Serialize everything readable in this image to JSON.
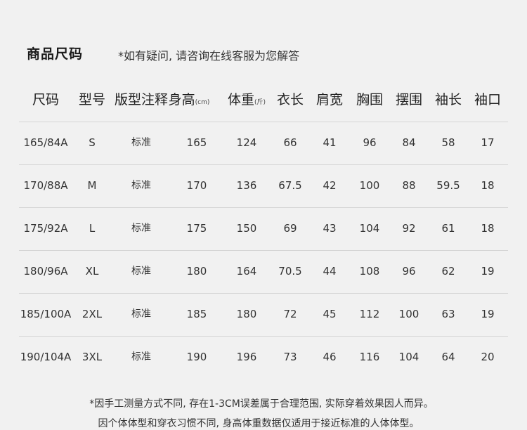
{
  "title": "商品尺码",
  "subtitle": "*如有疑问, 请咨询在线客服为您解答",
  "headers": [
    {
      "label": "尺码",
      "unit": ""
    },
    {
      "label": "型号",
      "unit": ""
    },
    {
      "label": "版型注释",
      "unit": ""
    },
    {
      "label": "身高",
      "unit": "(cm)"
    },
    {
      "label": "体重",
      "unit": "(斤)"
    },
    {
      "label": "衣长",
      "unit": ""
    },
    {
      "label": "肩宽",
      "unit": ""
    },
    {
      "label": "胸围",
      "unit": ""
    },
    {
      "label": "摆围",
      "unit": ""
    },
    {
      "label": "袖长",
      "unit": ""
    },
    {
      "label": "袖口",
      "unit": ""
    }
  ],
  "rows": [
    [
      "165/84A",
      "S",
      "标准",
      "165",
      "124",
      "66",
      "41",
      "96",
      "84",
      "58",
      "17"
    ],
    [
      "170/88A",
      "M",
      "标准",
      "170",
      "136",
      "67.5",
      "42",
      "100",
      "88",
      "59.5",
      "18"
    ],
    [
      "175/92A",
      "L",
      "标准",
      "175",
      "150",
      "69",
      "43",
      "104",
      "92",
      "61",
      "18"
    ],
    [
      "180/96A",
      "XL",
      "标准",
      "180",
      "164",
      "70.5",
      "44",
      "108",
      "96",
      "62",
      "19"
    ],
    [
      "185/100A",
      "2XL",
      "标准",
      "185",
      "180",
      "72",
      "45",
      "112",
      "100",
      "63",
      "19"
    ],
    [
      "190/104A",
      "3XL",
      "标准",
      "190",
      "196",
      "73",
      "46",
      "116",
      "104",
      "64",
      "20"
    ]
  ],
  "footer": {
    "line1": "*因手工测量方式不同, 存在1-3CM误差属于合理范围, 实际穿着效果因人而异。",
    "line2": "因个体体型和穿衣习惯不同, 身高体重数据仅适用于接近标准的人体体型。"
  }
}
